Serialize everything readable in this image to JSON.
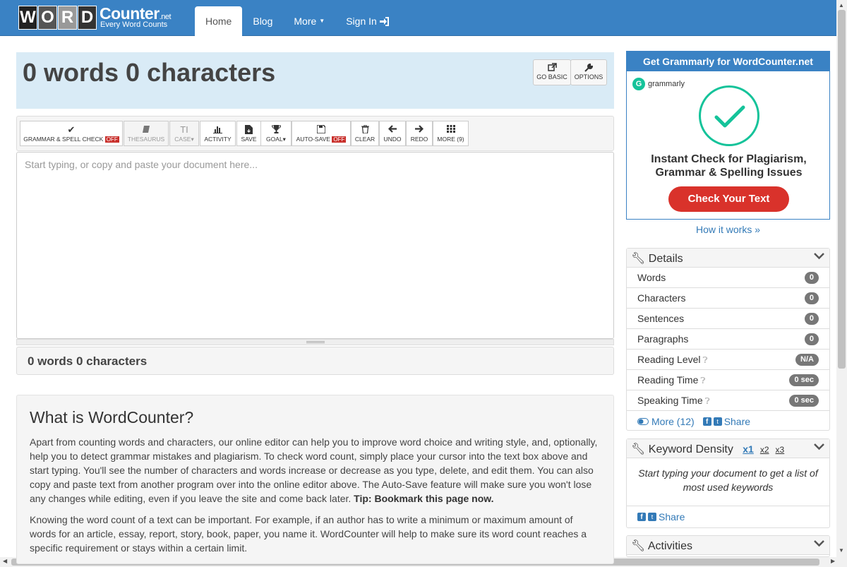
{
  "nav": {
    "logo_letters": [
      "W",
      "O",
      "R",
      "D"
    ],
    "logo_counter": "Counter",
    "logo_net": ".net",
    "logo_tagline": "Every Word Counts",
    "items": [
      {
        "label": "Home"
      },
      {
        "label": "Blog"
      },
      {
        "label": "More"
      },
      {
        "label": "Sign In"
      }
    ]
  },
  "header": {
    "title": "0 words 0 characters",
    "go_basic": "GO BASIC",
    "options": "OPTIONS"
  },
  "toolbar": {
    "grammar": "GRAMMAR & SPELL CHECK",
    "off": "OFF",
    "thesaurus": "THESAURUS",
    "case": "CASE",
    "activity": "ACTIVITY",
    "save": "SAVE",
    "goal": "GOAL",
    "autosave": "AUTO-SAVE",
    "clear": "CLEAR",
    "undo": "UNDO",
    "redo": "REDO",
    "more": "MORE (9)"
  },
  "editor": {
    "placeholder": "Start typing, or copy and paste your document here..."
  },
  "bottom_count": "0 words 0 characters",
  "article": {
    "title": "What is WordCounter?",
    "p1": "Apart from counting words and characters, our online editor can help you to improve word choice and writing style, and, optionally, help you to detect grammar mistakes and plagiarism. To check word count, simply place your cursor into the text box above and start typing. You'll see the number of characters and words increase or decrease as you type, delete, and edit them. You can also copy and paste text from another program over into the online editor above. The Auto-Save feature will make sure you won't lose any changes while editing, even if you leave the site and come back later. ",
    "p1_tip": "Tip: Bookmark this page now.",
    "p2": "Knowing the word count of a text can be important. For example, if an author has to write a minimum or maximum amount of words for an article, essay, report, story, book, paper, you name it. WordCounter will help to make sure its word count reaches a specific requirement or stays within a certain limit."
  },
  "ad": {
    "top": "Get Grammarly for WordCounter.net",
    "brand": "grammarly",
    "message_line1": "Instant Check for Plagiarism,",
    "message_line2": "Grammar & Spelling Issues",
    "cta": "Check Your Text"
  },
  "how_it_works": "How it works »",
  "details": {
    "title": "Details",
    "rows": [
      {
        "label": "Words",
        "value": "0"
      },
      {
        "label": "Characters",
        "value": "0"
      },
      {
        "label": "Sentences",
        "value": "0"
      },
      {
        "label": "Paragraphs",
        "value": "0"
      },
      {
        "label": "Reading Level",
        "value": "N/A"
      },
      {
        "label": "Reading Time",
        "value": "0 sec"
      },
      {
        "label": "Speaking Time",
        "value": "0 sec"
      }
    ],
    "more": "More (12)",
    "share": "Share"
  },
  "keyword": {
    "title": "Keyword Density",
    "x1": "x1",
    "x2": "x2",
    "x3": "x3",
    "empty": "Start typing your document to get a list of most used keywords",
    "share": "Share"
  },
  "activities": {
    "title": "Activities"
  },
  "colors": {
    "nav": "#3a82c4",
    "header_bg": "#d9ebf6",
    "off_badge": "#c9302c",
    "grammarly": "#15c39a",
    "cta": "#d9322b"
  }
}
